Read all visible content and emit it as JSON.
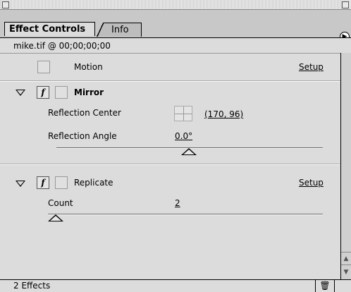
{
  "tabs": [
    {
      "label": "Effect Controls",
      "active": true
    },
    {
      "label": "Info",
      "active": false
    }
  ],
  "source_line": "mike.tif @ 00;00;00;00",
  "effects": {
    "motion": {
      "name": "Motion",
      "setup": "Setup"
    },
    "mirror": {
      "name": "Mirror",
      "fx_symbol": "f",
      "params": {
        "reflection_center_label": "Reflection Center",
        "reflection_center_value": "(170, 96)",
        "reflection_angle_label": "Reflection Angle",
        "reflection_angle_value": "0.0°"
      }
    },
    "replicate": {
      "name": "Replicate",
      "fx_symbol": "f",
      "setup": "Setup",
      "params": {
        "count_label": "Count",
        "count_value": "2"
      }
    }
  },
  "status": {
    "effects_count": "2 Effects",
    "trash_icon": "trash-icon"
  },
  "icons": {
    "menu_arrow": "▶",
    "scroll_up": "▲",
    "scroll_down": "▼",
    "trash": "🗑"
  }
}
